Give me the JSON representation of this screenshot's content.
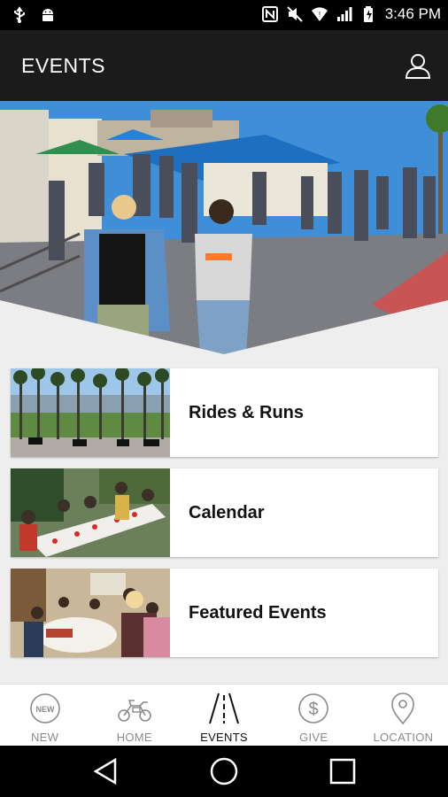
{
  "status_bar": {
    "time": "3:46 PM",
    "left_icons": [
      "usb-icon",
      "android-icon"
    ],
    "right_icons": [
      "nfc-icon",
      "mute-icon",
      "wifi-icon",
      "signal-icon",
      "battery-icon"
    ]
  },
  "app_bar": {
    "title": "EVENTS",
    "profile_icon": "profile-icon"
  },
  "hero": {
    "image": "outdoor-event-photo"
  },
  "event_list": [
    {
      "label": "Rides & Runs",
      "image": "palm-trees-motorcycles-photo"
    },
    {
      "label": "Calendar",
      "image": "table-gathering-photo"
    },
    {
      "label": "Featured Events",
      "image": "indoor-party-photo"
    }
  ],
  "bottom_nav": [
    {
      "label": "NEW",
      "icon": "new-badge-icon",
      "active": false
    },
    {
      "label": "HOME",
      "icon": "motorcycle-icon",
      "active": false
    },
    {
      "label": "EVENTS",
      "icon": "road-icon",
      "active": true
    },
    {
      "label": "GIVE",
      "icon": "dollar-icon",
      "active": false
    },
    {
      "label": "LOCATION",
      "icon": "location-pin-icon",
      "active": false
    }
  ],
  "system_nav": [
    "back-icon",
    "home-circle-icon",
    "recents-icon"
  ],
  "colors": {
    "app_bar": "#1b1b1b",
    "background": "#eeeeee",
    "active_nav": "#111111",
    "inactive_nav": "#8a8a8a"
  }
}
